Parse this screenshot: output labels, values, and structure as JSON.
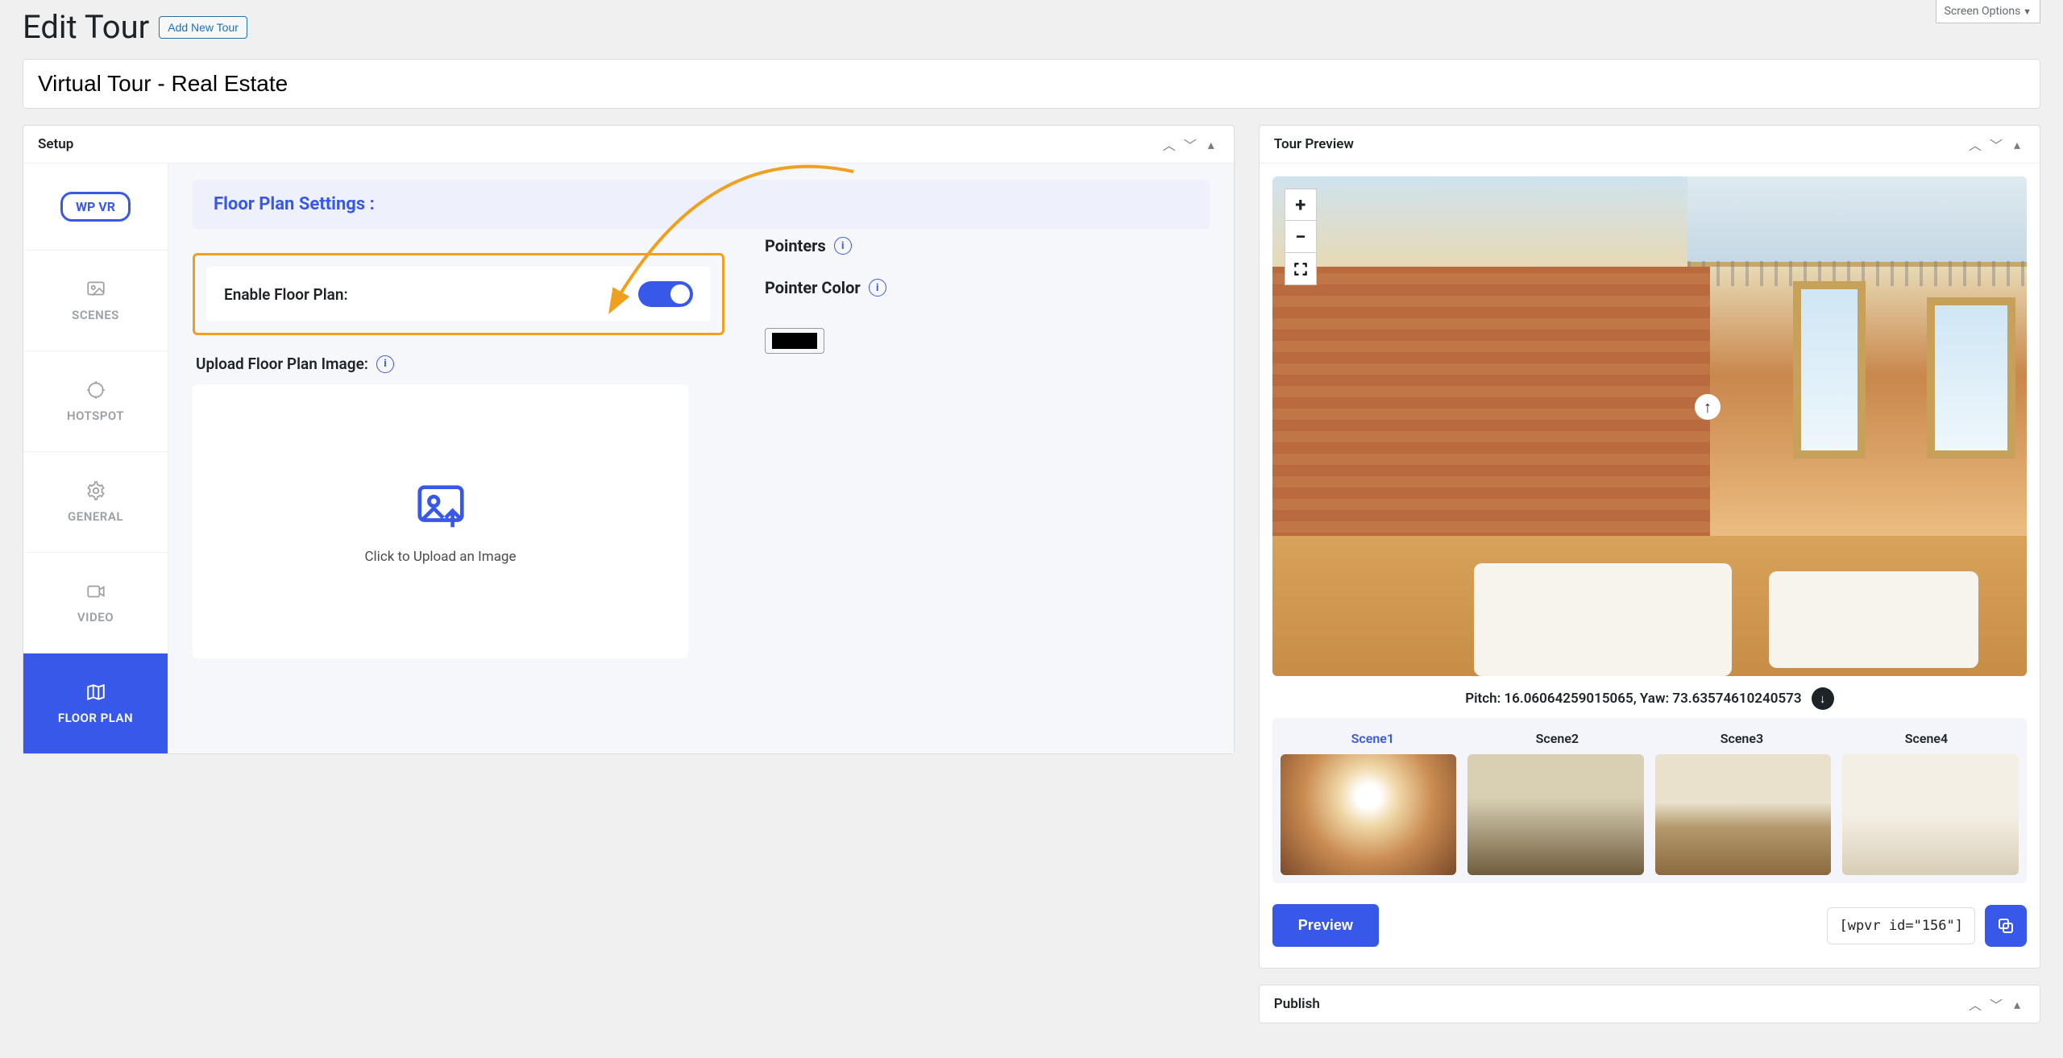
{
  "header": {
    "page_title": "Edit Tour",
    "add_new_label": "Add New Tour",
    "screen_options_label": "Screen Options"
  },
  "tour_title": "Virtual Tour - Real Estate",
  "setup_box": {
    "title": "Setup",
    "logo_text": "WP VR",
    "nav": {
      "scenes": "SCENES",
      "hotspot": "HOTSPOT",
      "general": "GENERAL",
      "video": "VIDEO",
      "floor_plan": "FLOOR PLAN"
    },
    "settings_title": "Floor Plan Settings :",
    "enable_label": "Enable Floor Plan:",
    "upload_label": "Upload Floor Plan Image:",
    "upload_cta": "Click to Upload an Image",
    "pointers_label": "Pointers",
    "pointer_color_label": "Pointer Color",
    "pointer_color_value": "#000000"
  },
  "preview_box": {
    "title": "Tour Preview",
    "zoom_in": "+",
    "zoom_out": "−",
    "pitch_label": "Pitch:",
    "pitch_value": "16.06064259015065",
    "yaw_label": "Yaw:",
    "yaw_value": "73.63574610240573",
    "scenes": [
      "Scene1",
      "Scene2",
      "Scene3",
      "Scene4"
    ],
    "preview_button": "Preview",
    "shortcode": "[wpvr id=\"156\"]"
  },
  "publish_box": {
    "title": "Publish"
  }
}
